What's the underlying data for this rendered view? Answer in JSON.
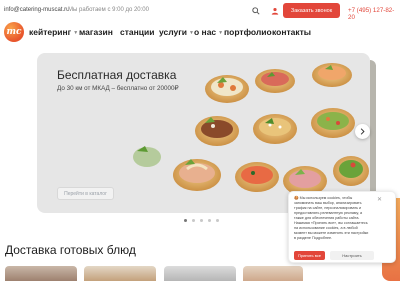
{
  "topbar": {
    "email": "info@catering-muscat.ru",
    "hours": "Мы работаем с 9:00 до 20:00",
    "order_call": "Заказать звонок",
    "phone": "+7 (495) 127-82-20"
  },
  "logo": {
    "text": "mc"
  },
  "nav": {
    "items": [
      {
        "label": "кейтеринг",
        "has_dropdown": true
      },
      {
        "label": "магазин",
        "has_dropdown": false
      },
      {
        "label": "станции",
        "has_dropdown": false
      },
      {
        "label": "услуги",
        "has_dropdown": true
      },
      {
        "label": "о нас",
        "has_dropdown": true
      },
      {
        "label": "портфолио",
        "has_dropdown": false
      },
      {
        "label": "контакты",
        "has_dropdown": false
      }
    ]
  },
  "hero": {
    "title": "Бесплатная доставка",
    "subtitle": "До 30 км от МКАД – бесплатно от 20000₽",
    "button": "Перейти в каталог",
    "slide_count": 5,
    "active_slide": 1
  },
  "section": {
    "title": "Доставка готовых блюд"
  },
  "cookie": {
    "text": "🍪 Мы используем cookies, чтобы запоминать ваш выбор, анализировать трафик на сайте, персонализировать и предоставлять релевантную рекламу, а также для обеспечения работы сайта. Нажимая «Принять все», вы соглашаетесь на использование cookies, а в любой момент вы можете изменить эти настройки в разделе Подробнее.",
    "accept": "Принять все",
    "configure": "Настроить"
  },
  "colors": {
    "accent": "#e2463a",
    "hero_bg": "#e6e6e6",
    "text": "#1d1d1d"
  },
  "icons": {
    "search": "search-icon",
    "user": "user-icon",
    "arrow": "arrow-right-icon",
    "close": "close-icon"
  }
}
